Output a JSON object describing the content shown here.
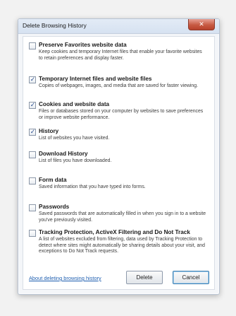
{
  "dialog": {
    "title": "Delete Browsing History",
    "close_label": "✕"
  },
  "options": [
    {
      "title": "Preserve Favorites website data",
      "description": "Keep cookies and temporary Internet files that enable your favorite websites to retain preferences and display faster.",
      "checked": false
    },
    {
      "title": "Temporary Internet files and website files",
      "description": "Copies of webpages, images, and media that are saved for faster viewing.",
      "checked": true
    },
    {
      "title": "Cookies and website data",
      "description": "Files or databases stored on your computer by websites to save preferences or improve website performance.",
      "checked": true
    },
    {
      "title": "History",
      "description": "List of websites you have visited.",
      "checked": true
    },
    {
      "title": "Download History",
      "description": "List of files you have downloaded.",
      "checked": false
    },
    {
      "title": "Form data",
      "description": "Saved information that you have typed into forms.",
      "checked": false
    },
    {
      "title": "Passwords",
      "description": "Saved passwords that are automatically filled in when you sign in to a website you've previously visited.",
      "checked": false
    },
    {
      "title": "Tracking Protection, ActiveX Filtering and Do Not Track",
      "description": "A list of websites excluded from filtering, data used by Tracking Protection to detect where sites might automatically be sharing details about your visit, and exceptions to Do Not Track requests.",
      "checked": false
    }
  ],
  "footer": {
    "link_label": "About deleting browsing history",
    "delete_label": "Delete",
    "cancel_label": "Cancel"
  },
  "check_mark": "✓"
}
